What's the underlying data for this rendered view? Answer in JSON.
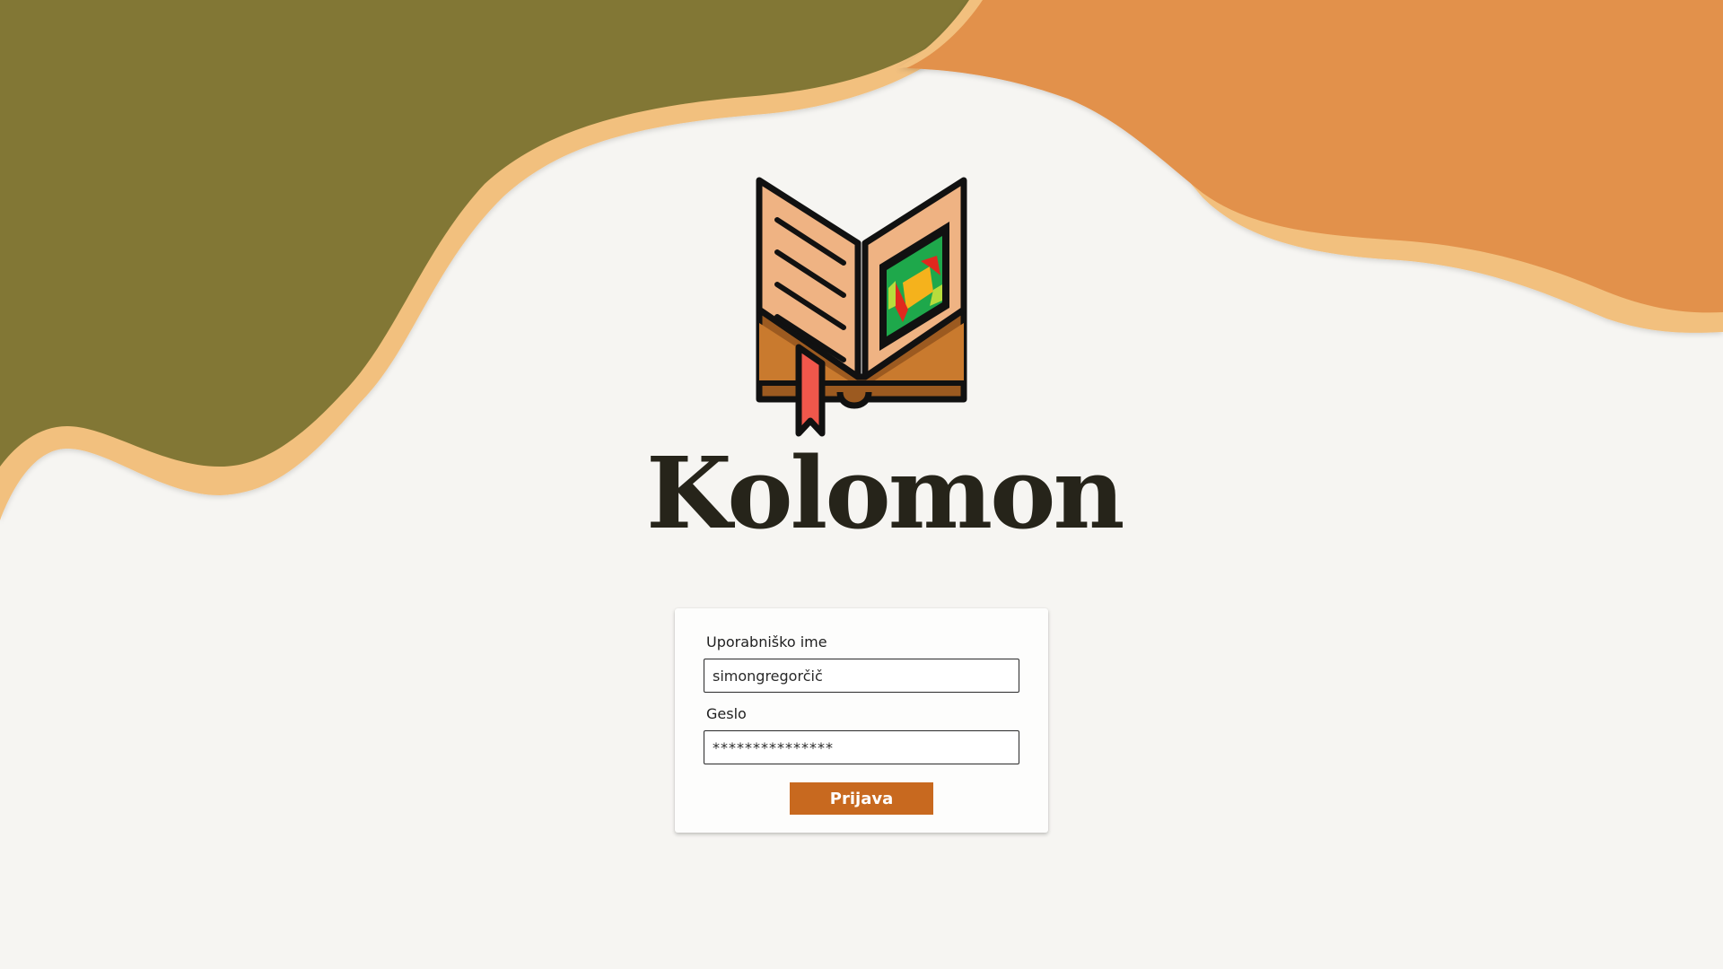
{
  "brand": {
    "name": "Kolomon"
  },
  "login": {
    "username_label": "Uporabniško ime",
    "username_value": "simongregorčič",
    "password_label": "Geslo",
    "password_value": "***************",
    "submit_label": "Prijava"
  },
  "colors": {
    "background": "#f6f5f2",
    "olive": "#827735",
    "orange": "#e2914b",
    "sand": "#f2c07e",
    "button": "#c8691f",
    "brand_text": "#26241a"
  },
  "icons": {
    "logo": "open-book-logo-icon"
  }
}
